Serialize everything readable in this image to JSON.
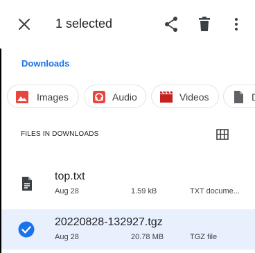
{
  "header": {
    "title": "1 selected",
    "icons": {
      "close": "close-icon",
      "share": "share-icon",
      "delete": "delete-icon",
      "more": "more-vert-icon"
    }
  },
  "breadcrumb": {
    "label": "Downloads"
  },
  "chips": [
    {
      "label": "Images",
      "icon": "image-icon",
      "color": "#e8453c"
    },
    {
      "label": "Audio",
      "icon": "audio-icon",
      "color": "#e8453c"
    },
    {
      "label": "Videos",
      "icon": "video-icon",
      "color": "#c5221f"
    },
    {
      "label": "D",
      "icon": "document-icon",
      "color": "#5f6368"
    }
  ],
  "section": {
    "label": "FILES IN DOWNLOADS",
    "view_toggle_icon": "grid-view-icon"
  },
  "files": [
    {
      "name": "top.txt",
      "date": "Aug 28",
      "size": "1.59 kB",
      "type": "TXT docume...",
      "icon": "text-file-icon",
      "selected": false
    },
    {
      "name": "20220828-132927.tgz",
      "date": "Aug 28",
      "size": "20.78 MB",
      "type": "TGZ file",
      "icon": "check-circle-icon",
      "selected": true
    }
  ],
  "colors": {
    "accent": "#1a73e8",
    "selected_row": "#e8f0fe",
    "red": "#e8453c"
  }
}
